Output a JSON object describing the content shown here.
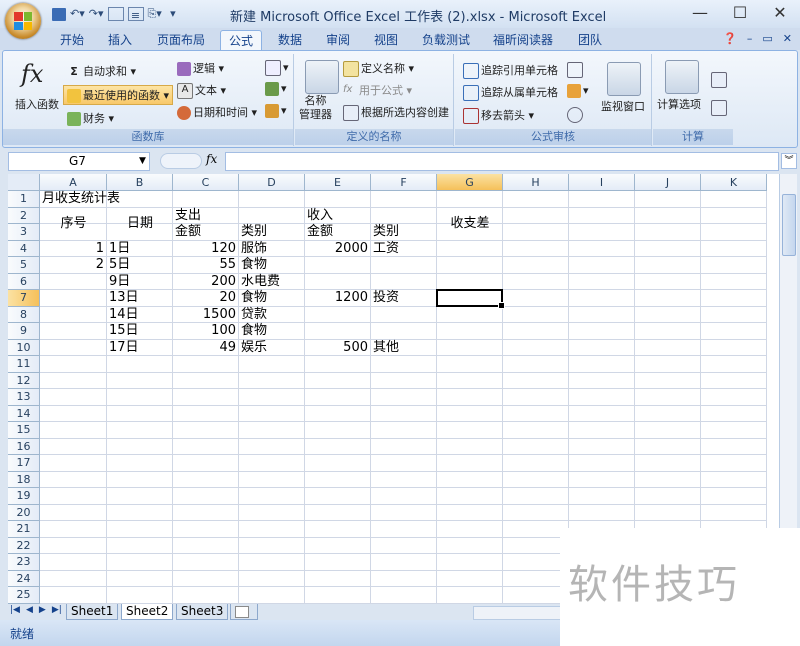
{
  "window": {
    "title": "新建 Microsoft Office Excel 工作表 (2).xlsx - Microsoft Excel",
    "minimize": "—",
    "maximize": "☐",
    "close": "✕"
  },
  "ribbon_tabs": [
    "开始",
    "插入",
    "页面布局",
    "公式",
    "数据",
    "审阅",
    "视图",
    "负载测试",
    "福昕阅读器",
    "团队"
  ],
  "active_tab": "公式",
  "ribbon": {
    "insert_function": "插入函数",
    "autosum": "自动求和",
    "recent": "最近使用的函数",
    "financial": "财务",
    "logical": "逻辑",
    "text": "文本",
    "datetime": "日期和时间",
    "group_library": "函数库",
    "name_manager": "名称\n管理器",
    "define_name": "定义名称",
    "use_in_formula": "用于公式",
    "create_from_sel": "根据所选内容创建",
    "group_names": "定义的名称",
    "trace_precedents": "追踪引用单元格",
    "trace_dependents": "追踪从属单元格",
    "remove_arrows": "移去箭头",
    "watch_window": "监视窗口",
    "group_audit": "公式审核",
    "calc_options": "计算选项",
    "group_calc": "计算"
  },
  "formula_bar": {
    "name_box": "G7",
    "fx": "fx",
    "formula": ""
  },
  "columns": [
    "A",
    "B",
    "C",
    "D",
    "E",
    "F",
    "G",
    "H",
    "I",
    "J",
    "K"
  ],
  "rows": [
    "1",
    "2",
    "3",
    "4",
    "5",
    "6",
    "7",
    "8",
    "9",
    "10",
    "11",
    "12",
    "13",
    "14",
    "15",
    "16",
    "17",
    "18",
    "19",
    "20",
    "21",
    "22",
    "23",
    "24",
    "25"
  ],
  "cells": {
    "A1": "月收支统计表",
    "A2": "序号",
    "B2": "日期",
    "C2": "支出",
    "E2": "收入",
    "G2": "收支差",
    "C3": "金额",
    "D3": "类别",
    "E3": "金额",
    "F3": "类别",
    "A4": "1",
    "B4": "1日",
    "C4": "120",
    "D4": "服饰",
    "E4": "2000",
    "F4": "工资",
    "A5": "2",
    "B5": "5日",
    "C5": "55",
    "D5": "食物",
    "B6": "9日",
    "C6": "200",
    "D6": "水电费",
    "B7": "13日",
    "C7": "20",
    "D7": "食物",
    "E7": "1200",
    "F7": "投资",
    "B8": "14日",
    "C8": "1500",
    "D8": "贷款",
    "B9": "15日",
    "C9": "100",
    "D9": "食物",
    "B10": "17日",
    "C10": "49",
    "D10": "娱乐",
    "E10": "500",
    "F10": "其他"
  },
  "sheets": [
    "Sheet1",
    "Sheet2",
    "Sheet3"
  ],
  "active_sheet": "Sheet2",
  "status": "就绪",
  "watermark": "软件技巧"
}
